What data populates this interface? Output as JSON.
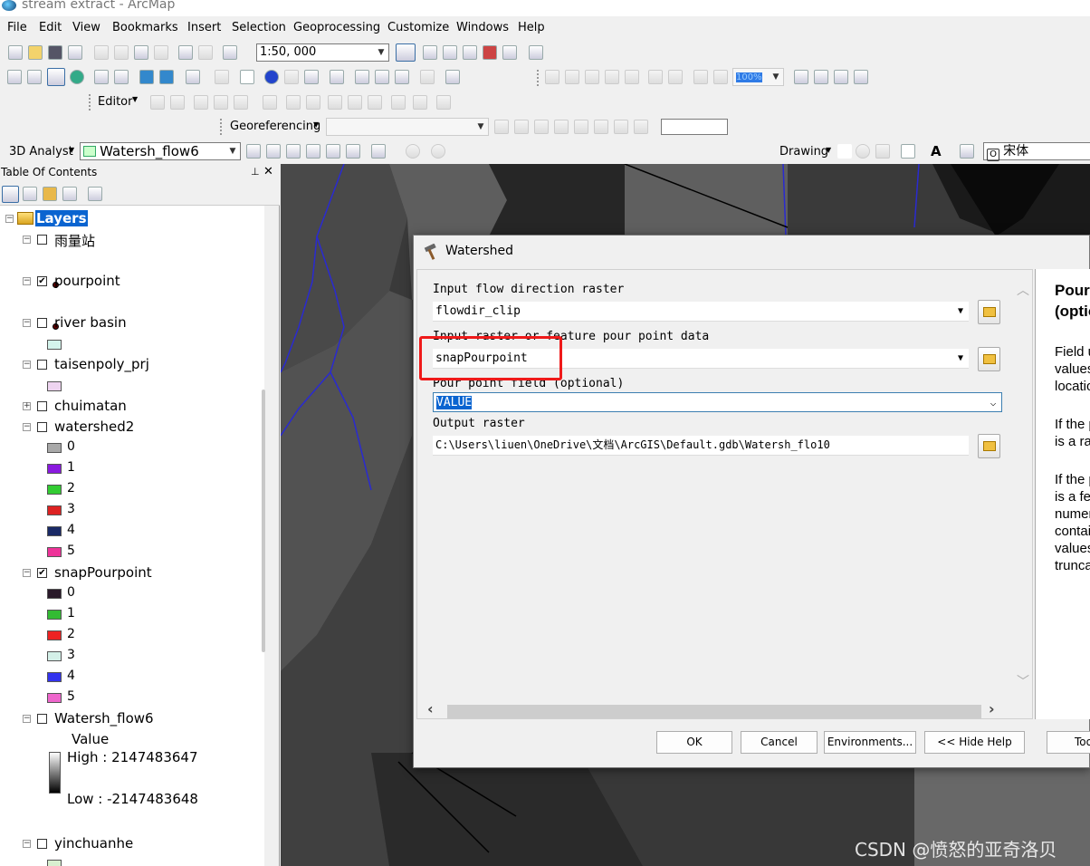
{
  "window": {
    "title": "stream extract - ArcMap"
  },
  "menu": [
    "File",
    "Edit",
    "View",
    "Bookmarks",
    "Insert",
    "Selection",
    "Geoprocessing",
    "Customize",
    "Windows",
    "Help"
  ],
  "toolbar": {
    "scale_value": "1:50, 000",
    "editor_label": "Editor",
    "georeferencing_label": "Georeferencing",
    "analyst_label": "3D Analyst",
    "layer_combo_value": "Watersh_flow6",
    "drawing_label": "Drawing",
    "font_combo_value": "宋体",
    "zoom_value": "100%"
  },
  "toc": {
    "title": "Table Of Contents",
    "root": "Layers",
    "layers": [
      {
        "name": "雨量站",
        "checked": false
      },
      {
        "name": "pourpoint",
        "checked": true
      },
      {
        "name": "river basin",
        "checked": false
      },
      {
        "name": "taisenpoly_prj",
        "checked": false
      },
      {
        "name": "chuimatan",
        "checked": false
      },
      {
        "name": "watershed2",
        "checked": false
      },
      {
        "name": "snapPourpoint",
        "checked": true
      },
      {
        "name": "Watersh_flow6",
        "checked": false
      },
      {
        "name": "yinchuanhe",
        "checked": false
      }
    ],
    "watershed2_classes": [
      {
        "label": "0",
        "color": "#a8a8a8"
      },
      {
        "label": "1",
        "color": "#8a1adf"
      },
      {
        "label": "2",
        "color": "#33cc33"
      },
      {
        "label": "3",
        "color": "#dd2222"
      },
      {
        "label": "4",
        "color": "#1a2a66"
      },
      {
        "label": "5",
        "color": "#ee3399"
      }
    ],
    "snap_classes": [
      {
        "label": "0",
        "color": "#2a1a2a"
      },
      {
        "label": "1",
        "color": "#33bb33"
      },
      {
        "label": "2",
        "color": "#ee2222"
      },
      {
        "label": "3",
        "color": "#d4f0e8"
      },
      {
        "label": "4",
        "color": "#3333ee"
      },
      {
        "label": "5",
        "color": "#ee66cc"
      }
    ],
    "river_basin_color": "#d4f4ec",
    "taisenpoly_color": "#eed4f0",
    "yinchuanhe_color": "#d8f0d0",
    "stretch": {
      "value_label": "Value",
      "high": "High : 2147483647",
      "low": "Low : -2147483648"
    }
  },
  "dialog": {
    "title": "Watershed",
    "fields": {
      "flow_label": "Input flow direction raster",
      "flow_value": "flowdir_clip",
      "pour_label": "Input raster or feature pour point data",
      "pour_value": "snapPourpoint",
      "field_label": "Pour point field (optional)",
      "field_value": "VALUE",
      "output_label": "Output raster",
      "output_value": "C:\\Users\\liuen\\OneDrive\\文档\\ArcGIS\\Default.gdb\\Watersh_flo10"
    },
    "buttons": {
      "ok": "OK",
      "cancel": "Cancel",
      "env": "Environments...",
      "hide_help": "<< Hide Help",
      "tool_help": "Tool Help"
    },
    "help": {
      "title1": "Pour point field",
      "title2": "(optional)",
      "p1": [
        "Field used to assign",
        "values to the pour point",
        "locations."
      ],
      "p2": [
        "If the pour point dataset",
        "is a raster, use Value."
      ],
      "p3": [
        "If the pour point dataset",
        "is a feature, use a",
        "numeric field. If the field",
        "contains floating-point",
        "values, they will be",
        "truncated into integers."
      ]
    }
  },
  "watermark": "CSDN @愤怒的亚奇洛贝"
}
